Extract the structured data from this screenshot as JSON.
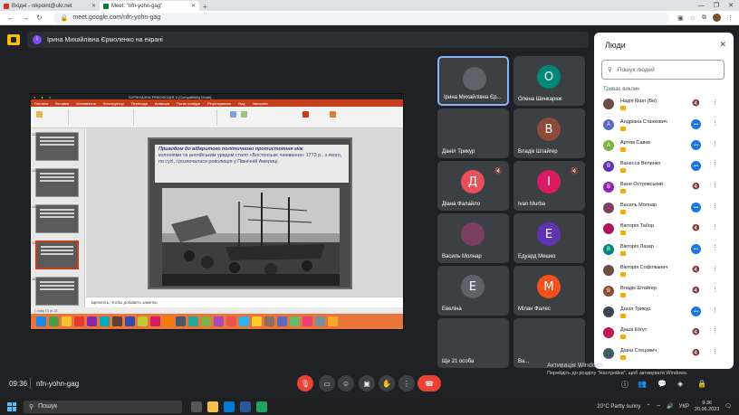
{
  "browser": {
    "tabs": [
      {
        "label": "Вхідні - nikpoint@ukr.net",
        "active": false
      },
      {
        "label": "Meet: \"nfn-yohn-gag\"",
        "active": true
      }
    ],
    "url": "meet.google.com/nfn-yohn-gag"
  },
  "meet": {
    "presenter_banner": "Ірина Михайлівна Єрмоленко на екрані",
    "presenter_initial": "І",
    "meeting_code": "nfn-yohn-gag",
    "time": "09:36"
  },
  "presentation": {
    "app_title": "БУРЖУАЗНА РЕВОЛЮЦІЯ V [Compatibility Mode]",
    "ribbon_tabs": [
      "Головна",
      "Вставка",
      "Малювання",
      "Конструктор",
      "Переходи",
      "Анімація",
      "Показ слайдів",
      "Рецензування",
      "Вид",
      "Записати"
    ],
    "slide_numbers": [
      "12",
      "13",
      "14",
      "15",
      "16"
    ],
    "slide_bold_text": "Приводом до відкритого політичного протистояння між",
    "slide_body": "колоніями та англійським урядом стало «Бостонське чаювання» 1773 р., з якого, по суті, і розпочалася революція у Північній Америці.",
    "notes_placeholder": "Щелкніть, чтобы добавить заметки",
    "status": "Слайд 15 из 24"
  },
  "tiles": [
    {
      "name": "Ірина Михайлівна Єр...",
      "initial": "",
      "color": "#5f6368",
      "muted": false,
      "active": true
    },
    {
      "name": "Олена Шинкарюк",
      "initial": "О",
      "color": "#00897b",
      "muted": false
    },
    {
      "name": "Даніл Трикур",
      "initial": "",
      "color": "#3c4043",
      "muted": false
    },
    {
      "name": "Владік Штайгер",
      "initial": "В",
      "color": "#8d4b39",
      "muted": false
    },
    {
      "name": "Діана Фалайло",
      "initial": "Д",
      "color": "#e8505b",
      "muted": true
    },
    {
      "name": "Ivan Murba",
      "initial": "І",
      "color": "#d81b60",
      "muted": true
    },
    {
      "name": "Василь Молнар",
      "initial": "",
      "color": "#7b3f61",
      "muted": false
    },
    {
      "name": "Едуард Мешко",
      "initial": "Е",
      "color": "#5e35b1",
      "muted": false
    },
    {
      "name": "Евеліна",
      "initial": "Е",
      "color": "#5f6368",
      "muted": false
    },
    {
      "name": "Мілан Фалес",
      "initial": "М",
      "color": "#f4511e",
      "muted": false
    },
    {
      "name": "Ще 21 особа",
      "initial": "",
      "color": "#3c4043",
      "muted": false
    },
    {
      "name": "Ва...",
      "initial": "",
      "color": "#3c4043",
      "muted": false
    }
  ],
  "panel": {
    "title": "Люди",
    "search_placeholder": "Пошук людей",
    "section": "Триває виклик",
    "people": [
      {
        "name": "Надія Кішл (Ви)",
        "initial": "",
        "color": "#6d4c41",
        "icon": "mute"
      },
      {
        "name": "Андріана Станкович",
        "initial": "A",
        "color": "#5c6bc0",
        "icon": "talk"
      },
      {
        "name": "Артем Савко",
        "initial": "A",
        "color": "#7cb342",
        "icon": "talk"
      },
      {
        "name": "Ванесса Велинко",
        "initial": "B",
        "color": "#5e35b1",
        "icon": "talk"
      },
      {
        "name": "Ваня Островський",
        "initial": "B",
        "color": "#8e24aa",
        "icon": "mute"
      },
      {
        "name": "Василь Молнар",
        "initial": "",
        "color": "#7b3f61",
        "icon": "talk"
      },
      {
        "name": "Вікторія Табор",
        "initial": "",
        "color": "#ad1457",
        "icon": "mute"
      },
      {
        "name": "Вікторія Лазар",
        "initial": "B",
        "color": "#00897b",
        "icon": "talk"
      },
      {
        "name": "Вікторія Софілканич",
        "initial": "",
        "color": "#6d4c41",
        "icon": "mute"
      },
      {
        "name": "Владік Штайгер",
        "initial": "B",
        "color": "#8d4b39",
        "icon": "mute"
      },
      {
        "name": "Даніл Трикур",
        "initial": "",
        "color": "#37474f",
        "icon": "talk"
      },
      {
        "name": "Даша Когут",
        "initial": "",
        "color": "#c2185b",
        "icon": "mute"
      },
      {
        "name": "Діана Стецович",
        "initial": "",
        "color": "#455a64",
        "icon": "mute"
      }
    ]
  },
  "windows": {
    "activate_title": "Активація Windows",
    "activate_sub": "Перейдіть до розділу \"Настройки\", щоб активувати Windows.",
    "search": "Пошук",
    "weather": "20°C  Partly sunny",
    "lang": "УКР",
    "clock_time": "9:36",
    "clock_date": "20.06.2023"
  }
}
